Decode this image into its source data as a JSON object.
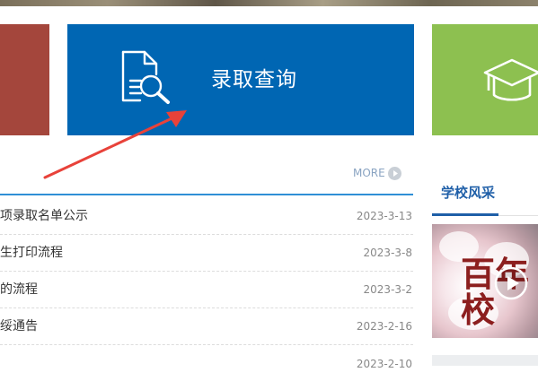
{
  "tiles": {
    "center_label": "录取查询",
    "center_icon": "document-search-icon",
    "right_icon": "graduation-cap-icon",
    "colors": {
      "red": "#a4463c",
      "blue": "#0066b3",
      "green": "#8dc050"
    }
  },
  "news": {
    "more_label": "MORE",
    "more_icon": "chevron-right-circle-icon",
    "items": [
      {
        "title": "项录取名单公示",
        "date": "2023-3-13"
      },
      {
        "title": "生打印流程",
        "date": "2023-3-8"
      },
      {
        "title": "的流程",
        "date": "2023-3-2"
      },
      {
        "title": "绥通告",
        "date": "2023-2-16"
      },
      {
        "title": "",
        "date": "2023-2-10"
      }
    ]
  },
  "sidebar": {
    "title": "学校风采",
    "video_icon": "play-circle-icon",
    "image_text": "百年校"
  },
  "annotation": {
    "arrow_color": "#e8423a"
  }
}
